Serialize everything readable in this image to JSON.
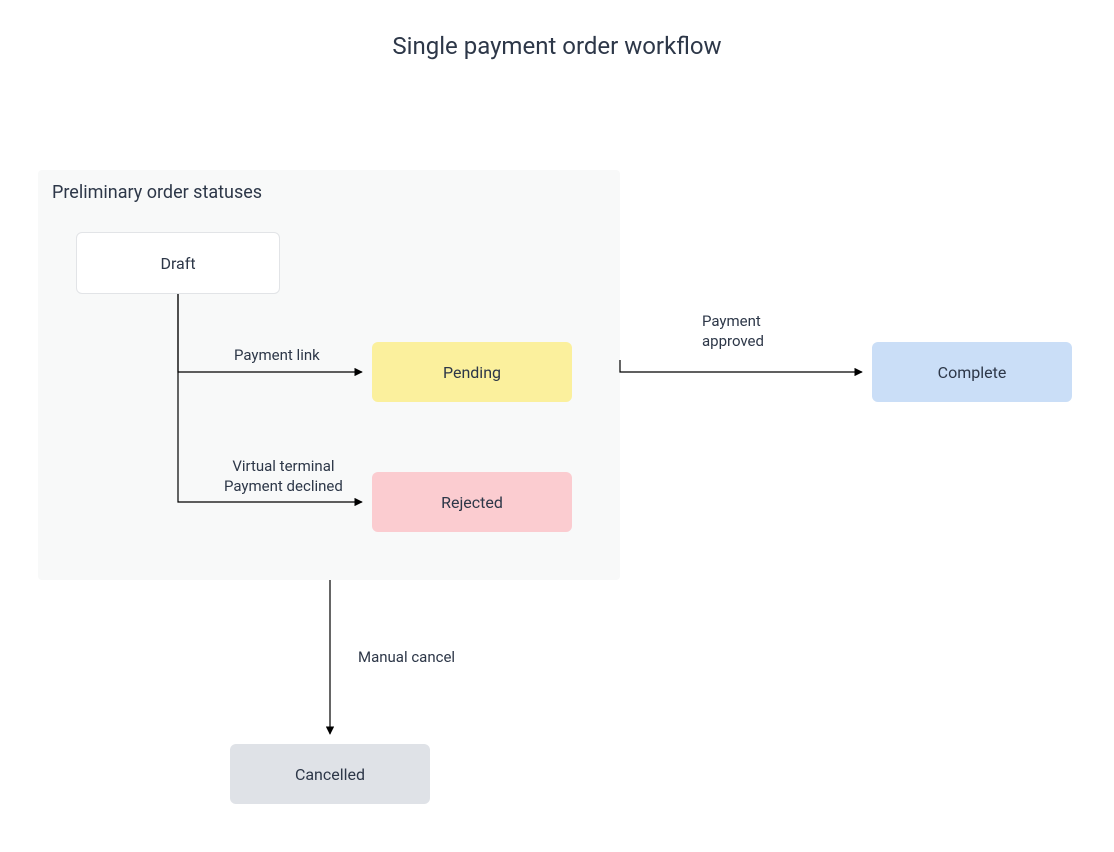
{
  "title": "Single payment order workflow",
  "group": {
    "label": "Preliminary order statuses"
  },
  "nodes": {
    "draft": "Draft",
    "pending": "Pending",
    "rejected": "Rejected",
    "complete": "Complete",
    "cancelled": "Cancelled"
  },
  "edges": {
    "payment_link": "Payment link",
    "virtual_terminal_line1": "Virtual terminal",
    "virtual_terminal_line2": "Payment declined",
    "approved_line1": "Payment",
    "approved_line2": "approved",
    "manual_cancel": "Manual cancel"
  },
  "colors": {
    "draft_bg": "#ffffff",
    "draft_border": "#e2e4e7",
    "pending_bg": "#fbf09d",
    "rejected_bg": "#fbccd0",
    "complete_bg": "#cadef7",
    "cancelled_bg": "#dfe2e7",
    "group_bg": "#f8f9f9",
    "text": "#2d3748",
    "line": "#000000"
  }
}
